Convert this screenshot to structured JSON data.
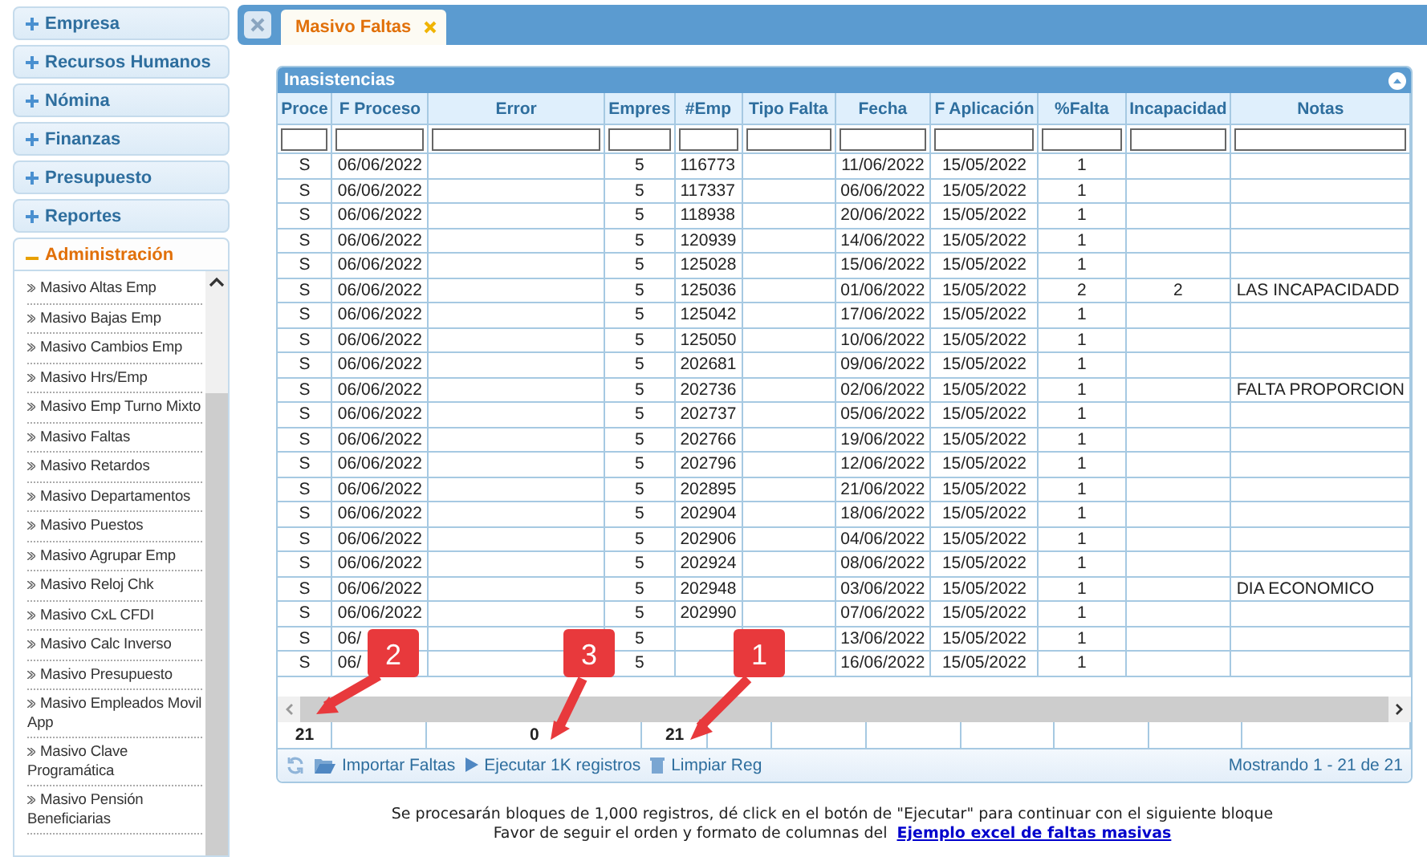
{
  "sidebar": {
    "sections": [
      {
        "label": "Empresa",
        "expanded": false
      },
      {
        "label": "Recursos Humanos",
        "expanded": false
      },
      {
        "label": "Nómina",
        "expanded": false
      },
      {
        "label": "Finanzas",
        "expanded": false
      },
      {
        "label": "Presupuesto",
        "expanded": false
      },
      {
        "label": "Reportes",
        "expanded": false
      },
      {
        "label": "Administración",
        "expanded": true,
        "items": [
          "Masivo Altas Emp",
          "Masivo Bajas Emp",
          "Masivo Cambios Emp",
          "Masivo Hrs/Emp",
          "Masivo Emp Turno Mixto",
          "Masivo Faltas",
          "Masivo Retardos",
          "Masivo Departamentos",
          "Masivo Puestos",
          "Masivo Agrupar Emp",
          "Masivo Reloj Chk",
          "Masivo CxL CFDI",
          "Masivo Calc Inverso",
          "Masivo Presupuesto",
          "Masivo Empleados Movil App",
          "Masivo Clave Programática",
          "Masivo Pensión Beneficiarias"
        ]
      }
    ]
  },
  "tabs": [
    {
      "label": "Masivo Faltas",
      "selected": true
    }
  ],
  "grid": {
    "title": "Inasistencias",
    "columns": [
      "Proce",
      "F Proceso",
      "Error",
      "Empres",
      "#Emp",
      "Tipo Falta",
      "Fecha",
      "F Aplicación",
      "%Falta",
      "Incapacidad",
      "Notas"
    ],
    "rows": [
      {
        "proceso": "S",
        "f_proceso": "06/06/2022",
        "empresa": "5",
        "emp": "116773",
        "fecha": "11/06/2022",
        "f_aplicacion": "15/05/2022",
        "falta": "1"
      },
      {
        "proceso": "S",
        "f_proceso": "06/06/2022",
        "empresa": "5",
        "emp": "117337",
        "fecha": "06/06/2022",
        "f_aplicacion": "15/05/2022",
        "falta": "1"
      },
      {
        "proceso": "S",
        "f_proceso": "06/06/2022",
        "empresa": "5",
        "emp": "118938",
        "fecha": "20/06/2022",
        "f_aplicacion": "15/05/2022",
        "falta": "1"
      },
      {
        "proceso": "S",
        "f_proceso": "06/06/2022",
        "empresa": "5",
        "emp": "120939",
        "fecha": "14/06/2022",
        "f_aplicacion": "15/05/2022",
        "falta": "1"
      },
      {
        "proceso": "S",
        "f_proceso": "06/06/2022",
        "empresa": "5",
        "emp": "125028",
        "fecha": "15/06/2022",
        "f_aplicacion": "15/05/2022",
        "falta": "1"
      },
      {
        "proceso": "S",
        "f_proceso": "06/06/2022",
        "empresa": "5",
        "emp": "125036",
        "fecha": "01/06/2022",
        "f_aplicacion": "15/05/2022",
        "falta": "2",
        "incapacidad": "2",
        "notas": "LAS INCAPACIDADD"
      },
      {
        "proceso": "S",
        "f_proceso": "06/06/2022",
        "empresa": "5",
        "emp": "125042",
        "fecha": "17/06/2022",
        "f_aplicacion": "15/05/2022",
        "falta": "1"
      },
      {
        "proceso": "S",
        "f_proceso": "06/06/2022",
        "empresa": "5",
        "emp": "125050",
        "fecha": "10/06/2022",
        "f_aplicacion": "15/05/2022",
        "falta": "1"
      },
      {
        "proceso": "S",
        "f_proceso": "06/06/2022",
        "empresa": "5",
        "emp": "202681",
        "fecha": "09/06/2022",
        "f_aplicacion": "15/05/2022",
        "falta": "1"
      },
      {
        "proceso": "S",
        "f_proceso": "06/06/2022",
        "empresa": "5",
        "emp": "202736",
        "fecha": "02/06/2022",
        "f_aplicacion": "15/05/2022",
        "falta": "1",
        "notas": "FALTA PROPORCION"
      },
      {
        "proceso": "S",
        "f_proceso": "06/06/2022",
        "empresa": "5",
        "emp": "202737",
        "fecha": "05/06/2022",
        "f_aplicacion": "15/05/2022",
        "falta": "1"
      },
      {
        "proceso": "S",
        "f_proceso": "06/06/2022",
        "empresa": "5",
        "emp": "202766",
        "fecha": "19/06/2022",
        "f_aplicacion": "15/05/2022",
        "falta": "1"
      },
      {
        "proceso": "S",
        "f_proceso": "06/06/2022",
        "empresa": "5",
        "emp": "202796",
        "fecha": "12/06/2022",
        "f_aplicacion": "15/05/2022",
        "falta": "1"
      },
      {
        "proceso": "S",
        "f_proceso": "06/06/2022",
        "empresa": "5",
        "emp": "202895",
        "fecha": "21/06/2022",
        "f_aplicacion": "15/05/2022",
        "falta": "1"
      },
      {
        "proceso": "S",
        "f_proceso": "06/06/2022",
        "empresa": "5",
        "emp": "202904",
        "fecha": "18/06/2022",
        "f_aplicacion": "15/05/2022",
        "falta": "1"
      },
      {
        "proceso": "S",
        "f_proceso": "06/06/2022",
        "empresa": "5",
        "emp": "202906",
        "fecha": "04/06/2022",
        "f_aplicacion": "15/05/2022",
        "falta": "1"
      },
      {
        "proceso": "S",
        "f_proceso": "06/06/2022",
        "empresa": "5",
        "emp": "202924",
        "fecha": "08/06/2022",
        "f_aplicacion": "15/05/2022",
        "falta": "1"
      },
      {
        "proceso": "S",
        "f_proceso": "06/06/2022",
        "empresa": "5",
        "emp": "202948",
        "fecha": "03/06/2022",
        "f_aplicacion": "15/05/2022",
        "falta": "1",
        "notas": "DIA ECONOMICO"
      },
      {
        "proceso": "S",
        "f_proceso": "06/06/2022",
        "empresa": "5",
        "emp": "202990",
        "fecha": "07/06/2022",
        "f_aplicacion": "15/05/2022",
        "falta": "1"
      },
      {
        "proceso": "S",
        "f_proceso": "06/",
        "empresa": "5",
        "fecha": "13/06/2022",
        "f_aplicacion": "15/05/2022",
        "falta": "1"
      },
      {
        "proceso": "S",
        "f_proceso": "06/",
        "empresa": "5",
        "fecha": "16/06/2022",
        "f_aplicacion": "15/05/2022",
        "falta": "1"
      }
    ],
    "totals": {
      "proceso": "21",
      "error": "0",
      "empresa": "21"
    },
    "toolbar": [
      "Importar Faltas",
      "Ejecutar 1K registros",
      "Limpiar Reg"
    ],
    "pager": "Mostrando 1 - 21 de 21"
  },
  "callouts": [
    {
      "label": "2"
    },
    {
      "label": "3"
    },
    {
      "label": "1"
    }
  ],
  "note": {
    "line1": "Se procesarán bloques de 1,000 registros, dé click en el botón de \"Ejecutar\" para continuar con el siguiente bloque",
    "line2": "Favor de seguir el orden y formato de columnas del",
    "link": "Ejemplo excel de faltas masivas"
  }
}
